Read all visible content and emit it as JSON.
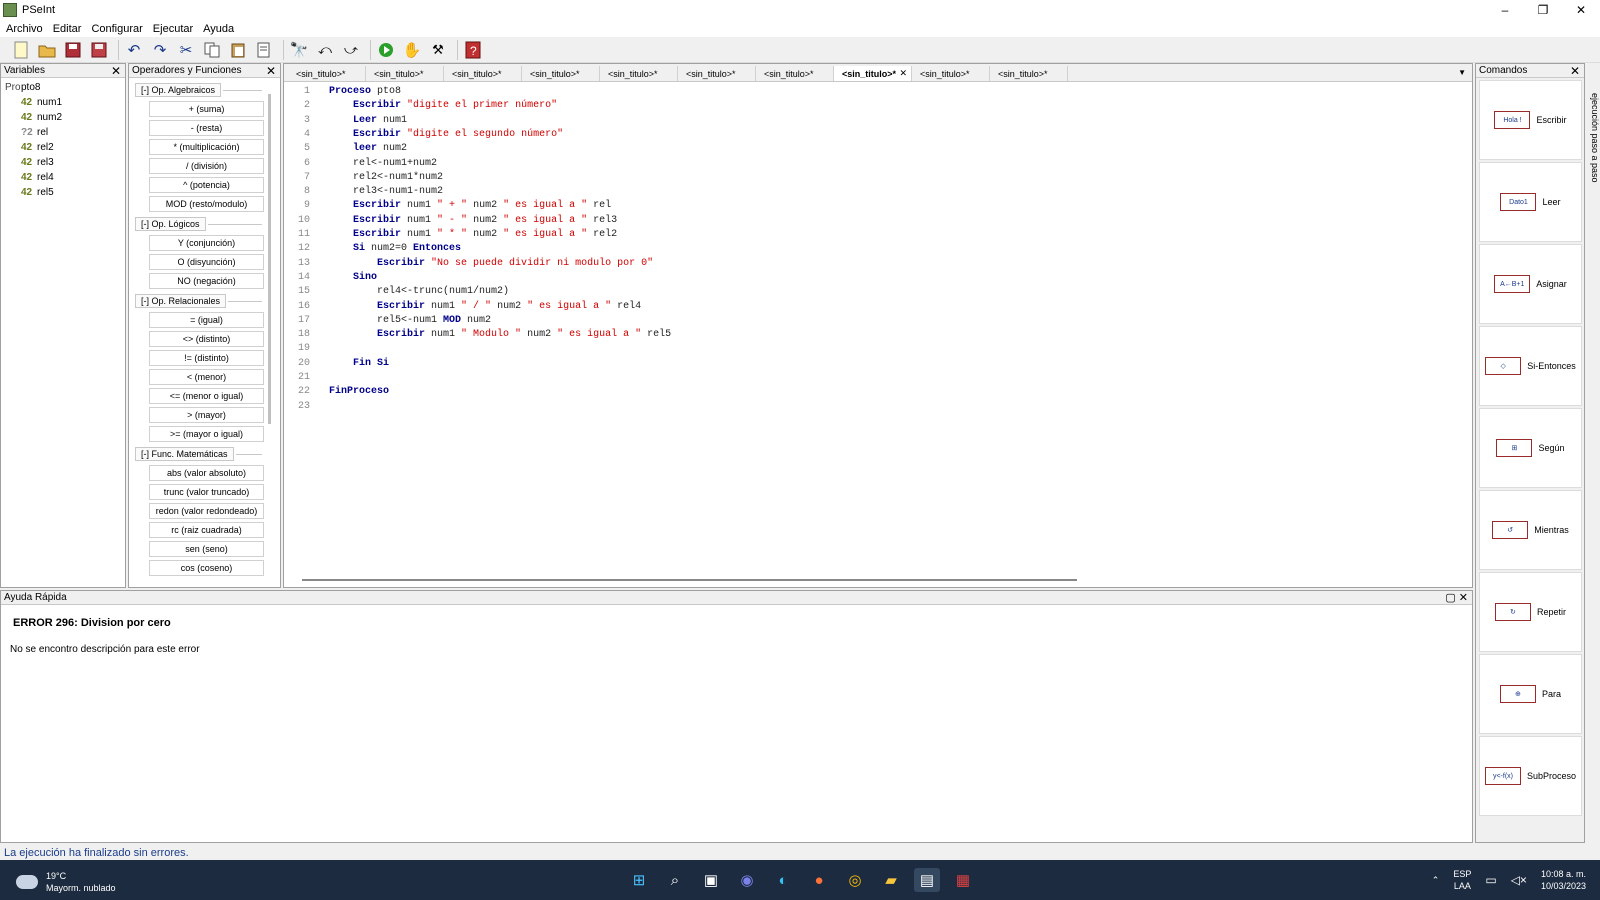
{
  "window": {
    "title": "PSeInt",
    "controls": [
      "–",
      "❐",
      "✕"
    ]
  },
  "menu": [
    "Archivo",
    "Editar",
    "Configurar",
    "Ejecutar",
    "Ayuda"
  ],
  "toolbar": {
    "icons": [
      "new-file-icon",
      "open-folder-icon",
      "save-icon",
      "save-as-icon",
      "undo-icon",
      "redo-icon",
      "cut-icon",
      "copy-icon",
      "paste-icon",
      "edit-icon",
      "find-icon",
      "find-prev-icon",
      "find-next-icon",
      "run-icon",
      "step-icon",
      "debug-icon",
      "help-icon"
    ]
  },
  "variables_panel": {
    "title": "Variables",
    "root": "pto8",
    "items": [
      "num1",
      "num2",
      "rel",
      "rel2",
      "rel3",
      "rel4",
      "rel5"
    ]
  },
  "operators_panel": {
    "title": "Operadores y Funciones",
    "groups": [
      {
        "label": "[-]  Op. Algebraicos",
        "items": [
          "+ (suma)",
          "- (resta)",
          "* (multiplicación)",
          "/ (división)",
          "^ (potencia)",
          "MOD (resto/modulo)"
        ]
      },
      {
        "label": "[-]  Op. Lógicos",
        "items": [
          "Y (conjunción)",
          "O (disyunción)",
          "NO (negación)"
        ]
      },
      {
        "label": "[-]  Op. Relacionales",
        "items": [
          "= (igual)",
          "<> (distinto)",
          "!= (distinto)",
          "< (menor)",
          "<= (menor o igual)",
          "> (mayor)",
          ">= (mayor o igual)"
        ]
      },
      {
        "label": "[-]  Func. Matemáticas",
        "items": [
          "abs (valor absoluto)",
          "trunc (valor truncado)",
          "redon (valor redondeado)",
          "rc (raiz cuadrada)",
          "sen (seno)",
          "cos (coseno)"
        ]
      }
    ]
  },
  "editor": {
    "tabs": [
      "<sin_titulo>*",
      "<sin_titulo>*",
      "<sin_titulo>*",
      "<sin_titulo>*",
      "<sin_titulo>*",
      "<sin_titulo>*",
      "<sin_titulo>*",
      "<sin_titulo>*",
      "<sin_titulo>*",
      "<sin_titulo>*"
    ],
    "active_tab": 7,
    "lines": [
      "Proceso pto8",
      "    Escribir \"digite el primer número\"",
      "    Leer num1",
      "    Escribir \"digite el segundo número\"",
      "    leer num2",
      "    rel<-num1+num2",
      "    rel2<-num1*num2",
      "    rel3<-num1-num2",
      "    Escribir num1 \" + \" num2 \" es igual a \" rel",
      "    Escribir num1 \" - \" num2 \" es igual a \" rel3",
      "    Escribir num1 \" * \" num2 \" es igual a \" rel2",
      "    Si num2=0 Entonces",
      "        Escribir \"No se puede dividir ni modulo por 0\"",
      "    Sino",
      "        rel4<-trunc(num1/num2)",
      "        Escribir num1 \" / \" num2 \" es igual a \" rel4",
      "        rel5<-num1 MOD num2",
      "        Escribir num1 \" Modulo \" num2 \" es igual a \" rel5",
      "",
      "    Fin Si",
      "",
      "FinProceso",
      ""
    ]
  },
  "commands_panel": {
    "title": "Comandos",
    "items": [
      {
        "label": "Escribir",
        "glyph": "Hola !"
      },
      {
        "label": "Leer",
        "glyph": "Dato1"
      },
      {
        "label": "Asignar",
        "glyph": "A←B+1"
      },
      {
        "label": "Si-Entonces",
        "glyph": "◇"
      },
      {
        "label": "Según",
        "glyph": "⊞"
      },
      {
        "label": "Mientras",
        "glyph": "↺"
      },
      {
        "label": "Repetir",
        "glyph": "↻"
      },
      {
        "label": "Para",
        "glyph": "⊕"
      },
      {
        "label": "SubProceso",
        "glyph": "y<-f(x)"
      }
    ],
    "side_label": "ejecución paso a paso"
  },
  "quick_help": {
    "title": "Ayuda Rápida",
    "error": "ERROR 296: Division por cero",
    "description": "No se encontro descripción para este error"
  },
  "status": "La ejecución ha finalizado sin errores.",
  "taskbar": {
    "temp": "19°C",
    "weather": "Mayorm. nublado",
    "lang1": "ESP",
    "lang2": "LAA",
    "time": "10:08 a. m.",
    "date": "10/03/2023"
  }
}
